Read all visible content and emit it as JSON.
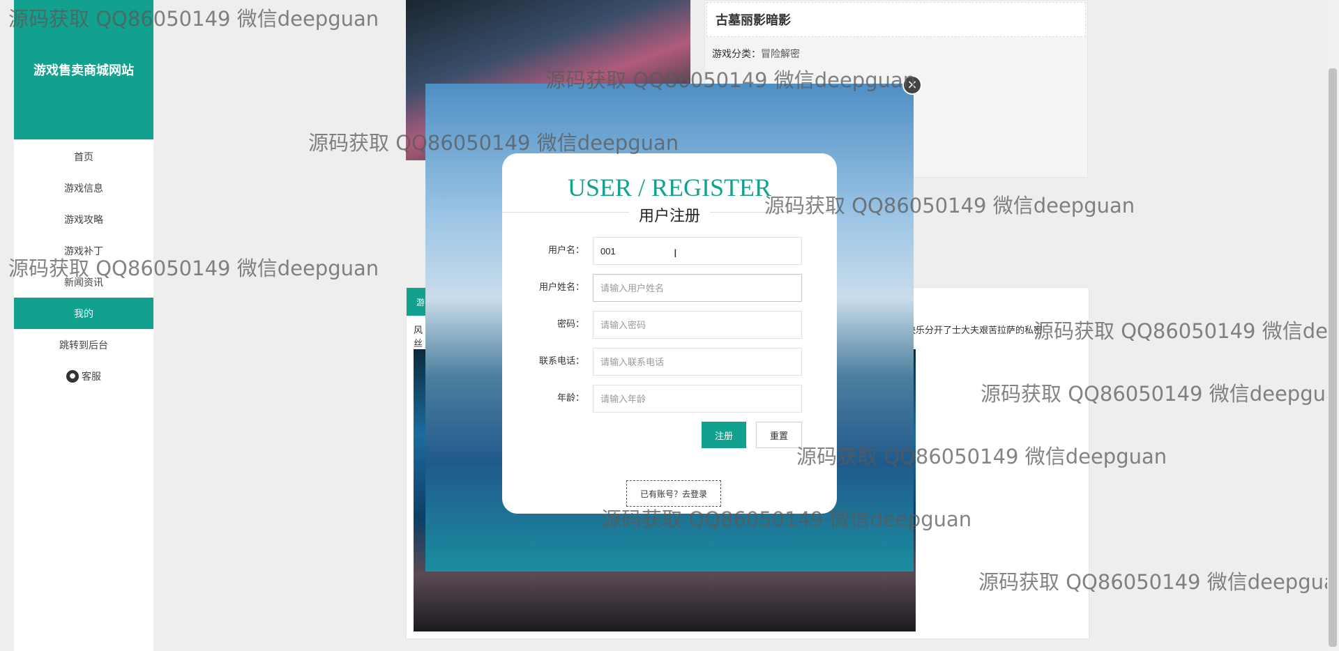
{
  "sidebar": {
    "logo": "游戏售卖商城网站",
    "items": [
      {
        "label": "首页",
        "active": false
      },
      {
        "label": "游戏信息",
        "active": false
      },
      {
        "label": "游戏攻略",
        "active": false
      },
      {
        "label": "游戏补丁",
        "active": false
      },
      {
        "label": "新闻资讯",
        "active": false
      },
      {
        "label": "我的",
        "active": true
      },
      {
        "label": "跳转到后台",
        "active": false
      }
    ],
    "service": {
      "label": "客服",
      "icon": "wechat-icon"
    }
  },
  "detail": {
    "title": "古墓丽影暗影",
    "category_label": "游戏分类：",
    "category_value": "冒险解密"
  },
  "section": {
    "tab": "游",
    "line_left": "风",
    "line_left2": "丝",
    "line_right": "疑快乐分开了士大夫艰苦拉萨的私密"
  },
  "modal": {
    "close_icon": "close-icon",
    "title": "USER / REGISTER",
    "subtitle": "用户注册",
    "fields": [
      {
        "label": "用户名：",
        "value": "001",
        "placeholder": ""
      },
      {
        "label": "用户姓名：",
        "value": "",
        "placeholder": "请输入用户姓名"
      },
      {
        "label": "密码：",
        "value": "",
        "placeholder": "请输入密码"
      },
      {
        "label": "联系电话：",
        "value": "",
        "placeholder": "请输入联系电话"
      },
      {
        "label": "年龄：",
        "value": "",
        "placeholder": "请输入年龄"
      }
    ],
    "submit": "注册",
    "reset": "重置",
    "login_link": "已有账号？去登录"
  },
  "watermark": "源码获取 QQ86050149 微信deepguan",
  "colors": {
    "accent": "#12a08f",
    "sidebar_bg": "#ffffff",
    "page_bg": "#eeeeee"
  }
}
